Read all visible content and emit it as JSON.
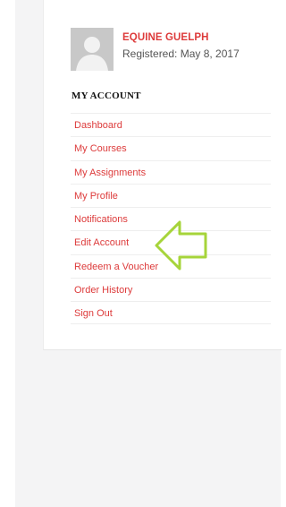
{
  "profile": {
    "name": "EQUINE GUELPH",
    "registered": "Registered: May 8, 2017"
  },
  "account": {
    "title": "MY ACCOUNT",
    "items": [
      {
        "label": "Dashboard"
      },
      {
        "label": "My Courses"
      },
      {
        "label": "My Assignments"
      },
      {
        "label": "My Profile"
      },
      {
        "label": "Notifications"
      },
      {
        "label": "Edit Account"
      },
      {
        "label": "Redeem a Voucher"
      },
      {
        "label": "Order History"
      },
      {
        "label": "Sign Out"
      }
    ]
  },
  "colors": {
    "accent": "#dd3b3b",
    "arrow_stroke": "#a6d43a",
    "page_background": "#f4f4f5"
  },
  "icons": {
    "avatar": "default-user-avatar-icon",
    "annotation": "left-pointing-arrow-icon"
  }
}
